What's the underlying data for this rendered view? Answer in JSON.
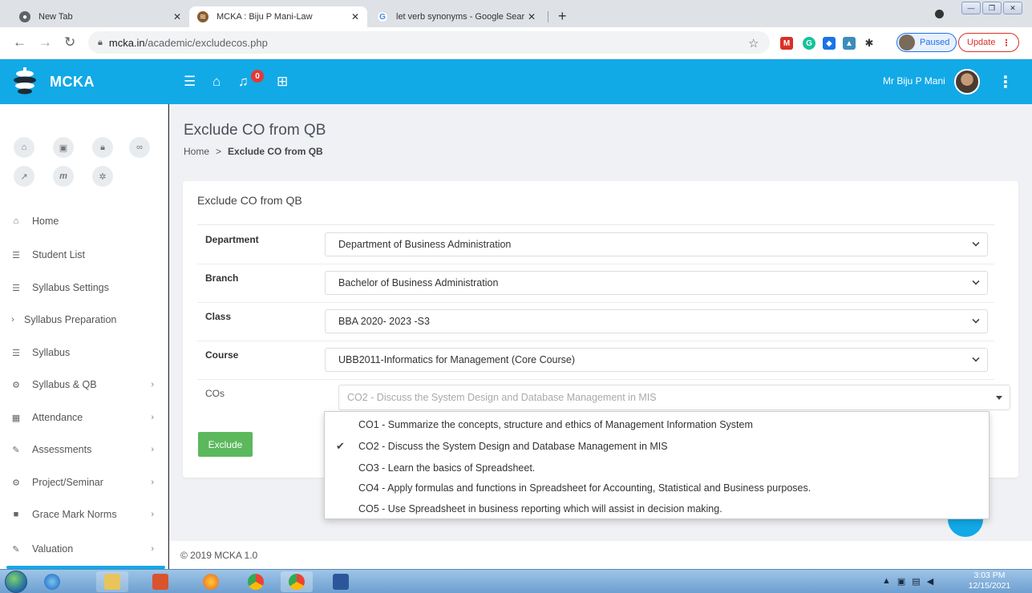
{
  "browser": {
    "tabs": [
      {
        "title": "New Tab"
      },
      {
        "title": "MCKA : Biju P Mani-Law"
      },
      {
        "title": "let verb synonyms - Google Sear"
      }
    ],
    "url_domain": "mcka.in",
    "url_path": "/academic/excludecos.php",
    "paused_label": "Paused",
    "update_label": "Update"
  },
  "header": {
    "brand": "MCKA",
    "notification_count": "0",
    "user_name": "Mr Biju P Mani"
  },
  "sidebar": {
    "items": [
      {
        "label": "Home",
        "icon": "home-icon",
        "chevron": false
      },
      {
        "label": "Student List",
        "icon": "list-icon",
        "chevron": false
      },
      {
        "label": "Syllabus Settings",
        "icon": "list-icon",
        "chevron": false
      },
      {
        "label": "Syllabus Preparation",
        "icon": "chevron-right-icon",
        "chevron": false
      },
      {
        "label": "Syllabus",
        "icon": "list-icon",
        "chevron": false
      },
      {
        "label": "Syllabus & QB",
        "icon": "cogs-icon",
        "chevron": true
      },
      {
        "label": "Attendance",
        "icon": "calendar-icon",
        "chevron": true
      },
      {
        "label": "Assessments",
        "icon": "pencil-icon",
        "chevron": true
      },
      {
        "label": "Project/Seminar",
        "icon": "cogs-icon",
        "chevron": true
      },
      {
        "label": "Grace Mark Norms",
        "icon": "book-icon",
        "chevron": true
      },
      {
        "label": "Valuation",
        "icon": "pencil-icon",
        "chevron": true
      }
    ]
  },
  "main": {
    "page_title": "Exclude CO from QB",
    "breadcrumb": {
      "home": "Home",
      "separator": ">",
      "current": "Exclude CO from QB"
    },
    "card_title": "Exclude CO from QB",
    "form": {
      "department": {
        "label": "Department",
        "value": "Department of Business Administration"
      },
      "branch": {
        "label": "Branch",
        "value": "Bachelor of Business Administration"
      },
      "class": {
        "label": "Class",
        "value": "BBA 2020- 2023 -S3"
      },
      "course": {
        "label": "Course",
        "value": "UBB2011-Informatics for Management (Core Course)"
      },
      "cos": {
        "label": "COs",
        "value": "CO2 - Discuss the System Design and Database Management in MIS"
      }
    },
    "exclude_label": "Exclude",
    "co_options": [
      {
        "label": "CO1 - Summarize the concepts, structure and ethics of Management Information System",
        "checked": false
      },
      {
        "label": "CO2 - Discuss the System Design and Database Management in MIS",
        "checked": true
      },
      {
        "label": "CO3 - Learn the basics of Spreadsheet.",
        "checked": false
      },
      {
        "label": "CO4 - Apply formulas and functions in Spreadsheet for Accounting, Statistical and Business purposes.",
        "checked": false
      },
      {
        "label": "CO5 - Use Spreadsheet in business reporting which will assist in decision making.",
        "checked": false
      }
    ]
  },
  "footer": {
    "text": "© 2019 MCKA 1.0"
  },
  "taskbar": {
    "time": "3:03 PM",
    "date": "12/15/2021"
  },
  "colors": {
    "accent": "#12a9e7",
    "exclude_button": "#5cb85c",
    "badge": "#e53935"
  }
}
